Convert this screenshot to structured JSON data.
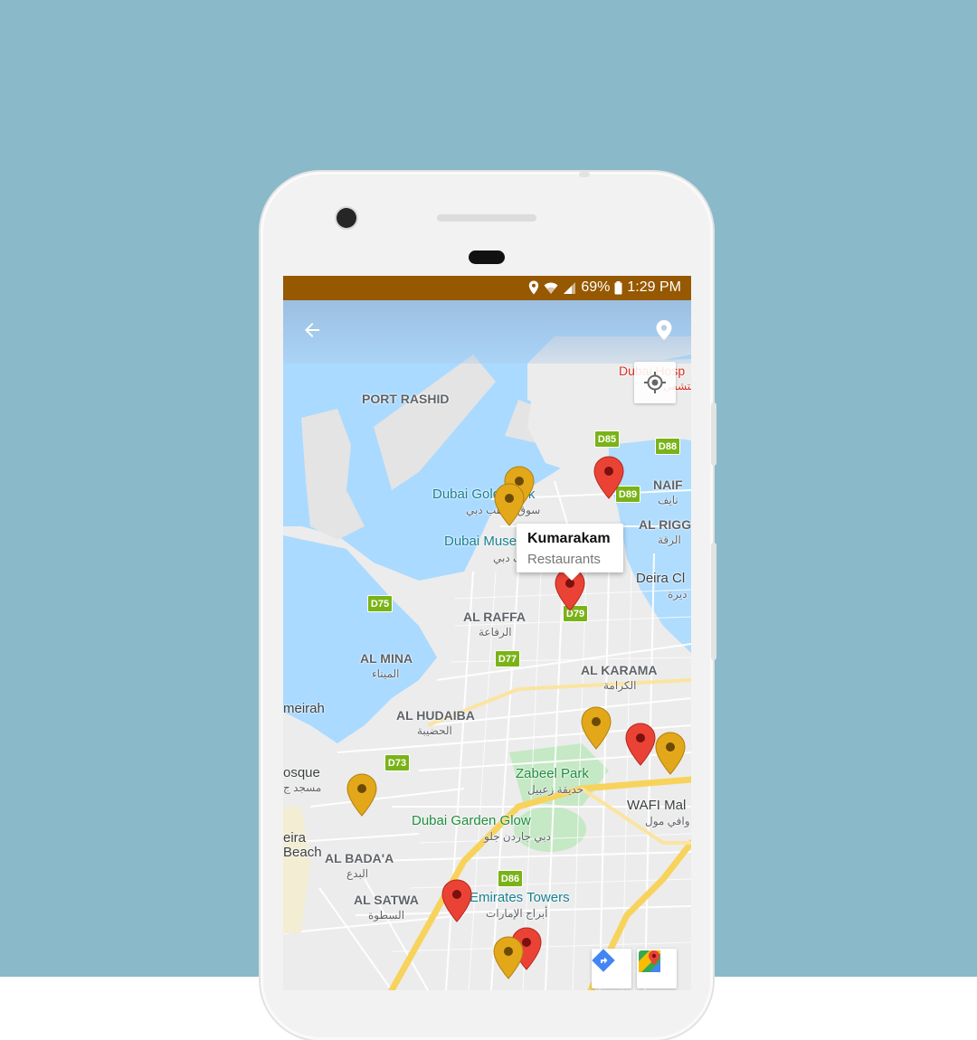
{
  "colors": {
    "background": "#8ab9c9",
    "status_bar": "#965800",
    "water": "#aadaff",
    "land": "#ececec",
    "park": "#c5e8c5",
    "pin_red": "#ea4335",
    "pin_gold": "#e3a81a",
    "shield": "#7ab317"
  },
  "status_bar": {
    "battery": "69%",
    "time": "1:29 PM",
    "icons": [
      "location-icon",
      "wifi-icon",
      "signal-icon",
      "battery-icon"
    ]
  },
  "app_bar": {
    "back_icon": "arrow-left-icon",
    "action_icon": "map-pin-icon"
  },
  "map": {
    "labels": {
      "port_rashid": "PORT RASHID",
      "dubai_hospital": "Dubai Hosp",
      "dubai_hospital_ar": "مستشفى",
      "dubai_gold_souk": "Dubai Gold Souk",
      "dubai_gold_souk_ar": "سوق الذهب دبي",
      "naif": "NAIF",
      "naif_ar": "نايف",
      "al_rigga": "AL RIGG",
      "al_rigga_ar": "الرقة",
      "dubai_museum": "Dubai Muse",
      "dubai_museum_ar": "متحف دبي",
      "deira_city": "Deira Cl",
      "deira_city_ar": "ديرة",
      "al_raffa": "AL RAFFA",
      "al_raffa_ar": "الرفاعة",
      "al_mina": "AL MINA",
      "al_mina_ar": "الميناء",
      "al_karama": "AL KARAMA",
      "al_karama_ar": "الكرامة",
      "jumeirah": "meirah",
      "al_hudaiba": "AL HUDAIBA",
      "al_hudaiba_ar": "الحضيبة",
      "mosque": "osque",
      "mosque_ar": "مسجد ج",
      "zabeel_park": "Zabeel Park",
      "zabeel_park_ar": "حديقة زعبيل",
      "wafi_mall": "WAFI Mal",
      "wafi_mall_ar": "وافي مول",
      "dubai_garden_glow": "Dubai Garden Glow",
      "dubai_garden_glow_ar": "دبي جاردن جلو",
      "jumeira_beach_1": "eira",
      "jumeira_beach_2": "Beach",
      "al_badaa": "AL BADA'A",
      "al_badaa_ar": "البدع",
      "al_satwa": "AL SATWA",
      "al_satwa_ar": "السطوة",
      "emirates_towers": "Emirates Towers",
      "emirates_towers_ar": "أبراج الإمارات"
    },
    "shields": {
      "d85": "D85",
      "d88": "D88",
      "d89": "D89",
      "d75": "D75",
      "d79": "D79",
      "d77": "D77",
      "d73": "D73",
      "d86": "D86"
    },
    "info_window": {
      "title": "Kumarakam",
      "subtitle": "Restaurants"
    },
    "controls": [
      "my-location-icon",
      "directions-icon",
      "google-maps-icon"
    ]
  }
}
